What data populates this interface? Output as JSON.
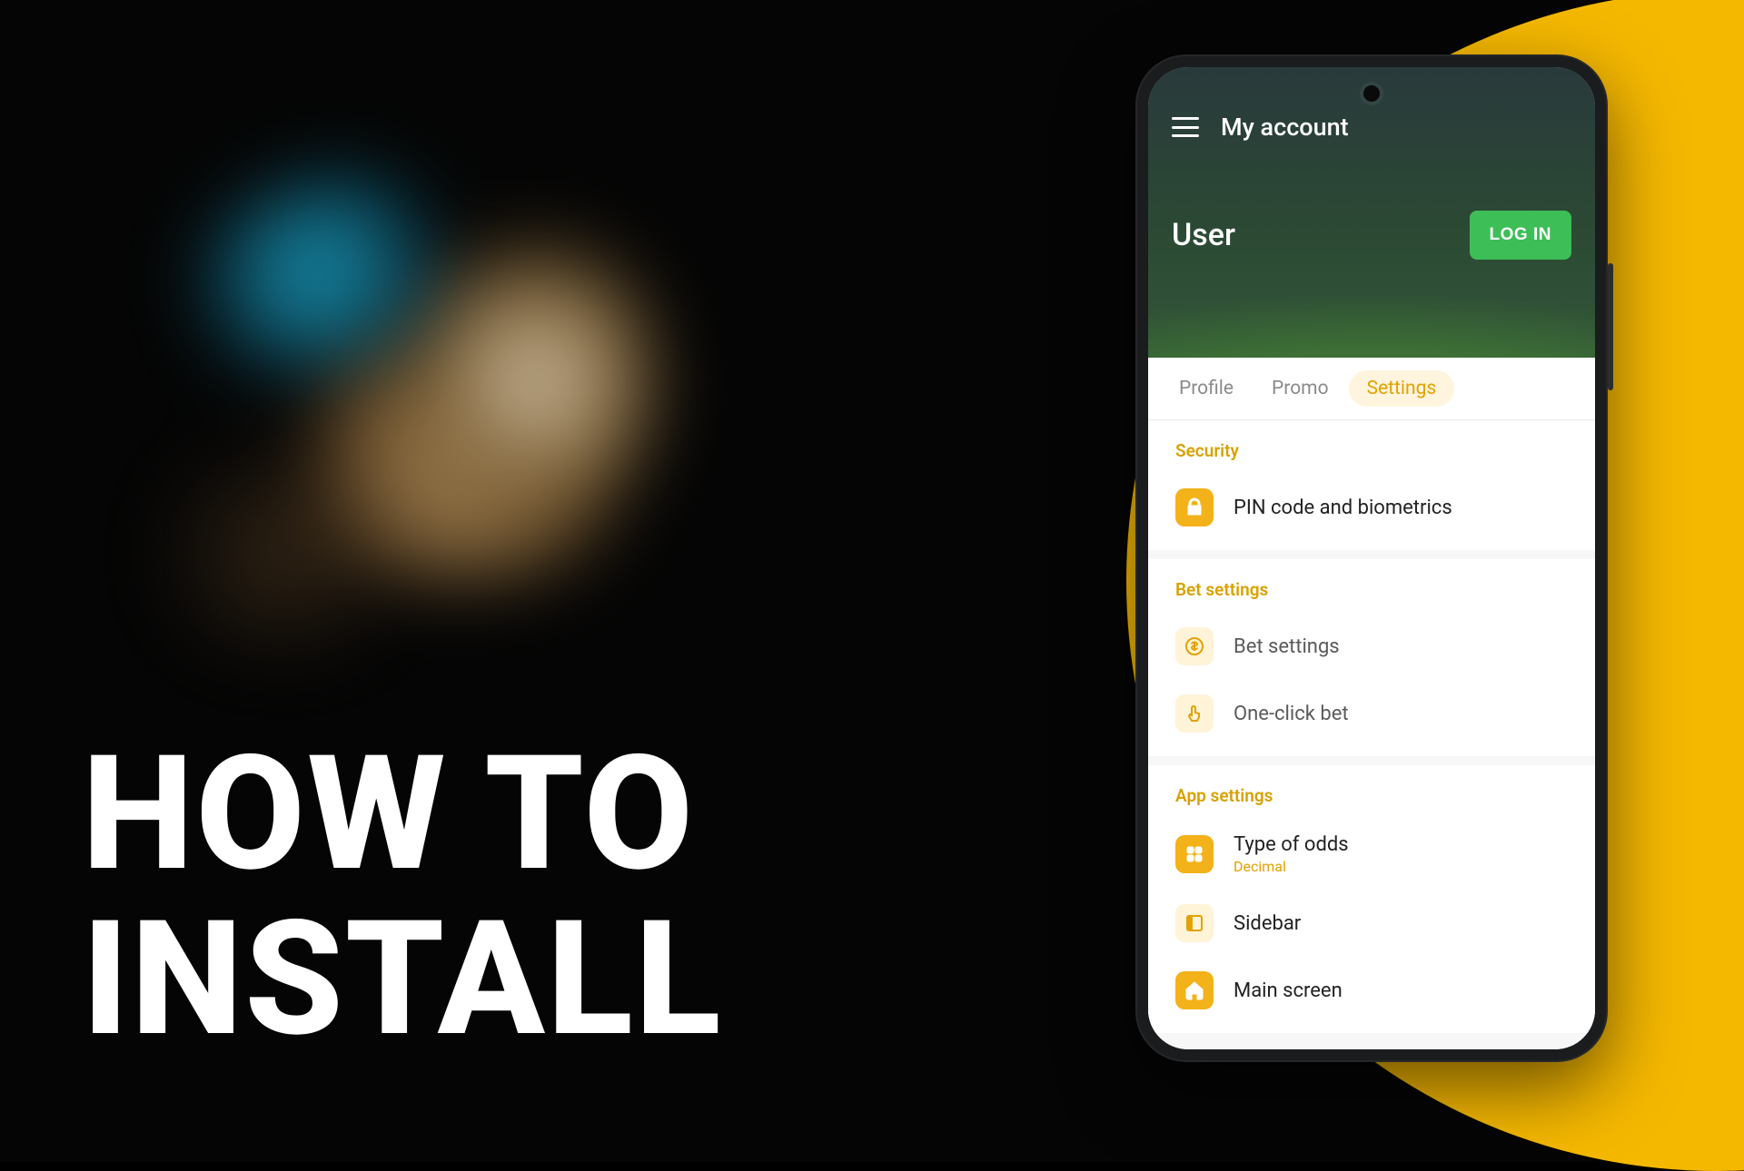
{
  "headline": {
    "line1": "HOW TO",
    "line2": "INSTALL"
  },
  "app": {
    "header_title": "My account",
    "user_label": "User",
    "login_label": "LOG IN",
    "tabs": {
      "profile": "Profile",
      "promo": "Promo",
      "settings": "Settings"
    },
    "sections": {
      "security": {
        "title": "Security",
        "pin_label": "PIN code and biometrics"
      },
      "bet": {
        "title": "Bet settings",
        "bet_settings_label": "Bet settings",
        "one_click_label": "One-click bet"
      },
      "app_settings": {
        "title": "App settings",
        "odds_label": "Type of odds",
        "odds_value": "Decimal",
        "sidebar_label": "Sidebar",
        "main_screen_label": "Main screen"
      }
    }
  }
}
